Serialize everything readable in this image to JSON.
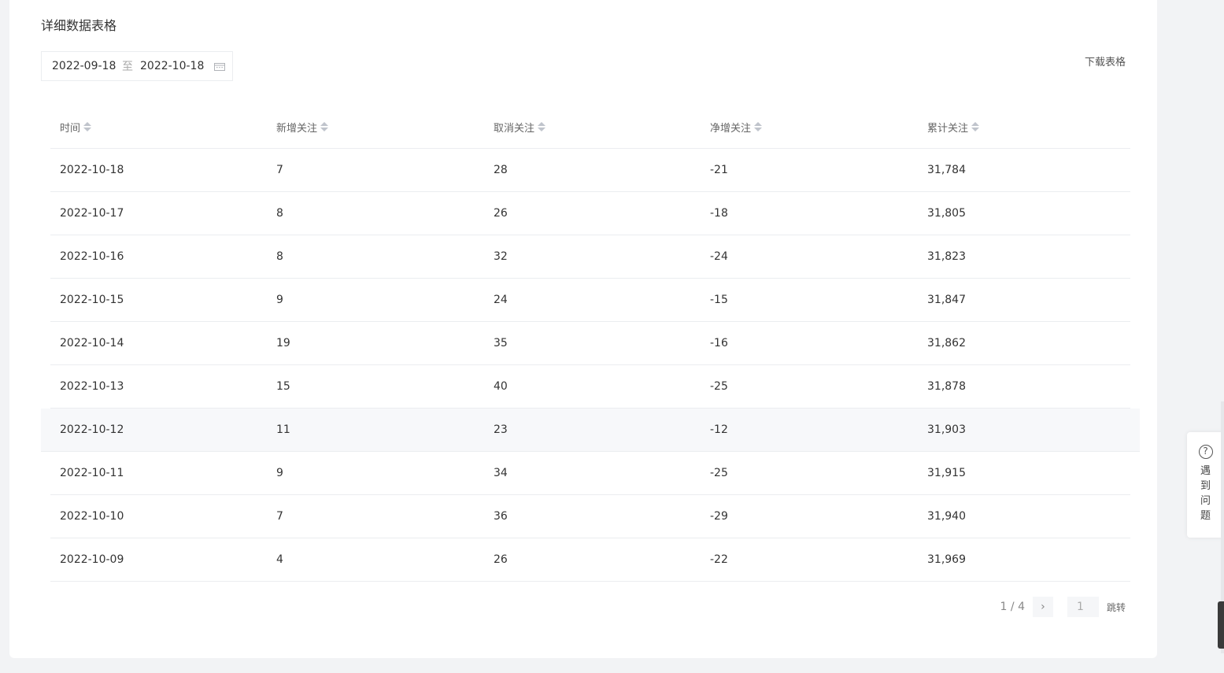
{
  "section": {
    "title": "详细数据表格"
  },
  "date_range": {
    "start": "2022-09-18",
    "separator": "至",
    "end": "2022-10-18"
  },
  "toolbar": {
    "download_label": "下载表格"
  },
  "table": {
    "headers": [
      "时间",
      "新增关注",
      "取消关注",
      "净增关注",
      "累计关注"
    ],
    "rows": [
      [
        "2022-10-18",
        "7",
        "28",
        "-21",
        "31,784"
      ],
      [
        "2022-10-17",
        "8",
        "26",
        "-18",
        "31,805"
      ],
      [
        "2022-10-16",
        "8",
        "32",
        "-24",
        "31,823"
      ],
      [
        "2022-10-15",
        "9",
        "24",
        "-15",
        "31,847"
      ],
      [
        "2022-10-14",
        "19",
        "35",
        "-16",
        "31,862"
      ],
      [
        "2022-10-13",
        "15",
        "40",
        "-25",
        "31,878"
      ],
      [
        "2022-10-12",
        "11",
        "23",
        "-12",
        "31,903"
      ],
      [
        "2022-10-11",
        "9",
        "34",
        "-25",
        "31,915"
      ],
      [
        "2022-10-10",
        "7",
        "36",
        "-29",
        "31,940"
      ],
      [
        "2022-10-09",
        "4",
        "26",
        "-22",
        "31,969"
      ]
    ]
  },
  "pagination": {
    "page_info": "1 / 4",
    "next_icon": "›",
    "page_input_value": "1",
    "jump_label": "跳转"
  },
  "help_widget": {
    "icon": "?",
    "label": "遇到问题"
  },
  "colors": {
    "background": "#f2f3f5",
    "card": "#ffffff",
    "border": "#ebedf0",
    "hover_row": "#f7f8fa"
  }
}
